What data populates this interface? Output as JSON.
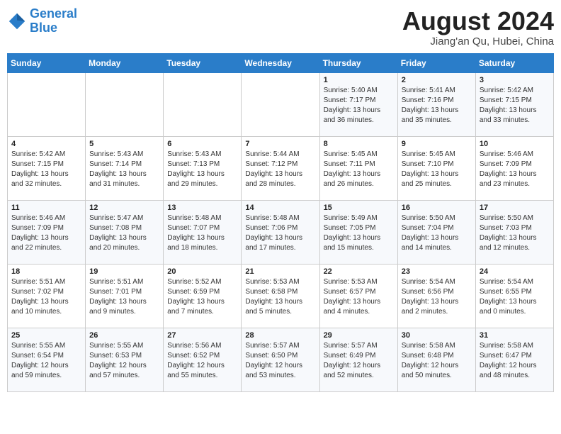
{
  "header": {
    "logo_general": "General",
    "logo_blue": "Blue",
    "month_year": "August 2024",
    "location": "Jiang'an Qu, Hubei, China"
  },
  "days_of_week": [
    "Sunday",
    "Monday",
    "Tuesday",
    "Wednesday",
    "Thursday",
    "Friday",
    "Saturday"
  ],
  "weeks": [
    [
      {
        "day": "",
        "info": ""
      },
      {
        "day": "",
        "info": ""
      },
      {
        "day": "",
        "info": ""
      },
      {
        "day": "",
        "info": ""
      },
      {
        "day": "1",
        "info": "Sunrise: 5:40 AM\nSunset: 7:17 PM\nDaylight: 13 hours\nand 36 minutes."
      },
      {
        "day": "2",
        "info": "Sunrise: 5:41 AM\nSunset: 7:16 PM\nDaylight: 13 hours\nand 35 minutes."
      },
      {
        "day": "3",
        "info": "Sunrise: 5:42 AM\nSunset: 7:15 PM\nDaylight: 13 hours\nand 33 minutes."
      }
    ],
    [
      {
        "day": "4",
        "info": "Sunrise: 5:42 AM\nSunset: 7:15 PM\nDaylight: 13 hours\nand 32 minutes."
      },
      {
        "day": "5",
        "info": "Sunrise: 5:43 AM\nSunset: 7:14 PM\nDaylight: 13 hours\nand 31 minutes."
      },
      {
        "day": "6",
        "info": "Sunrise: 5:43 AM\nSunset: 7:13 PM\nDaylight: 13 hours\nand 29 minutes."
      },
      {
        "day": "7",
        "info": "Sunrise: 5:44 AM\nSunset: 7:12 PM\nDaylight: 13 hours\nand 28 minutes."
      },
      {
        "day": "8",
        "info": "Sunrise: 5:45 AM\nSunset: 7:11 PM\nDaylight: 13 hours\nand 26 minutes."
      },
      {
        "day": "9",
        "info": "Sunrise: 5:45 AM\nSunset: 7:10 PM\nDaylight: 13 hours\nand 25 minutes."
      },
      {
        "day": "10",
        "info": "Sunrise: 5:46 AM\nSunset: 7:09 PM\nDaylight: 13 hours\nand 23 minutes."
      }
    ],
    [
      {
        "day": "11",
        "info": "Sunrise: 5:46 AM\nSunset: 7:09 PM\nDaylight: 13 hours\nand 22 minutes."
      },
      {
        "day": "12",
        "info": "Sunrise: 5:47 AM\nSunset: 7:08 PM\nDaylight: 13 hours\nand 20 minutes."
      },
      {
        "day": "13",
        "info": "Sunrise: 5:48 AM\nSunset: 7:07 PM\nDaylight: 13 hours\nand 18 minutes."
      },
      {
        "day": "14",
        "info": "Sunrise: 5:48 AM\nSunset: 7:06 PM\nDaylight: 13 hours\nand 17 minutes."
      },
      {
        "day": "15",
        "info": "Sunrise: 5:49 AM\nSunset: 7:05 PM\nDaylight: 13 hours\nand 15 minutes."
      },
      {
        "day": "16",
        "info": "Sunrise: 5:50 AM\nSunset: 7:04 PM\nDaylight: 13 hours\nand 14 minutes."
      },
      {
        "day": "17",
        "info": "Sunrise: 5:50 AM\nSunset: 7:03 PM\nDaylight: 13 hours\nand 12 minutes."
      }
    ],
    [
      {
        "day": "18",
        "info": "Sunrise: 5:51 AM\nSunset: 7:02 PM\nDaylight: 13 hours\nand 10 minutes."
      },
      {
        "day": "19",
        "info": "Sunrise: 5:51 AM\nSunset: 7:01 PM\nDaylight: 13 hours\nand 9 minutes."
      },
      {
        "day": "20",
        "info": "Sunrise: 5:52 AM\nSunset: 6:59 PM\nDaylight: 13 hours\nand 7 minutes."
      },
      {
        "day": "21",
        "info": "Sunrise: 5:53 AM\nSunset: 6:58 PM\nDaylight: 13 hours\nand 5 minutes."
      },
      {
        "day": "22",
        "info": "Sunrise: 5:53 AM\nSunset: 6:57 PM\nDaylight: 13 hours\nand 4 minutes."
      },
      {
        "day": "23",
        "info": "Sunrise: 5:54 AM\nSunset: 6:56 PM\nDaylight: 13 hours\nand 2 minutes."
      },
      {
        "day": "24",
        "info": "Sunrise: 5:54 AM\nSunset: 6:55 PM\nDaylight: 13 hours\nand 0 minutes."
      }
    ],
    [
      {
        "day": "25",
        "info": "Sunrise: 5:55 AM\nSunset: 6:54 PM\nDaylight: 12 hours\nand 59 minutes."
      },
      {
        "day": "26",
        "info": "Sunrise: 5:55 AM\nSunset: 6:53 PM\nDaylight: 12 hours\nand 57 minutes."
      },
      {
        "day": "27",
        "info": "Sunrise: 5:56 AM\nSunset: 6:52 PM\nDaylight: 12 hours\nand 55 minutes."
      },
      {
        "day": "28",
        "info": "Sunrise: 5:57 AM\nSunset: 6:50 PM\nDaylight: 12 hours\nand 53 minutes."
      },
      {
        "day": "29",
        "info": "Sunrise: 5:57 AM\nSunset: 6:49 PM\nDaylight: 12 hours\nand 52 minutes."
      },
      {
        "day": "30",
        "info": "Sunrise: 5:58 AM\nSunset: 6:48 PM\nDaylight: 12 hours\nand 50 minutes."
      },
      {
        "day": "31",
        "info": "Sunrise: 5:58 AM\nSunset: 6:47 PM\nDaylight: 12 hours\nand 48 minutes."
      }
    ]
  ]
}
